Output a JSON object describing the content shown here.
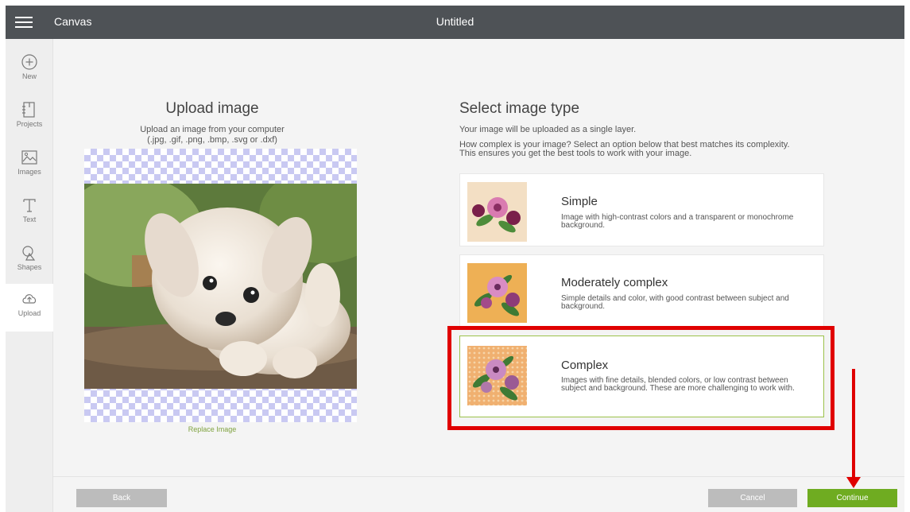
{
  "header": {
    "app_title": "Canvas",
    "doc_title": "Untitled"
  },
  "sidebar": {
    "items": [
      {
        "label": "New",
        "icon": "plus-circle-icon"
      },
      {
        "label": "Projects",
        "icon": "projects-icon"
      },
      {
        "label": "Images",
        "icon": "images-icon"
      },
      {
        "label": "Text",
        "icon": "text-icon"
      },
      {
        "label": "Shapes",
        "icon": "shapes-icon"
      },
      {
        "label": "Upload",
        "icon": "cloud-upload-icon",
        "active": true
      }
    ]
  },
  "upload": {
    "title": "Upload image",
    "desc_line1": "Upload an image from your computer",
    "desc_line2": "(.jpg, .gif, .png, .bmp, .svg or .dxf)",
    "replace_label": "Replace Image"
  },
  "image_type": {
    "title": "Select image type",
    "subtitle": "Your image will be uploaded as a single layer.",
    "question_line1": "How complex is your image? Select an option below that best matches its complexity.",
    "question_line2": "This ensures you get the best tools to work with your image.",
    "options": [
      {
        "title": "Simple",
        "desc": "Image with high-contrast colors and a transparent or monochrome background."
      },
      {
        "title": "Moderately complex",
        "desc": "Simple details and color, with good contrast between subject and background."
      },
      {
        "title": "Complex",
        "desc": "Images with fine details, blended colors, or low contrast between subject and background. These are more challenging to work with.",
        "selected": true
      }
    ]
  },
  "footer": {
    "back_label": "Back",
    "cancel_label": "Cancel",
    "continue_label": "Continue"
  },
  "colors": {
    "topbar": "#4e5256",
    "accent": "#6fac21",
    "annotation": "#e00000",
    "button_gray": "#bcbcbc"
  }
}
